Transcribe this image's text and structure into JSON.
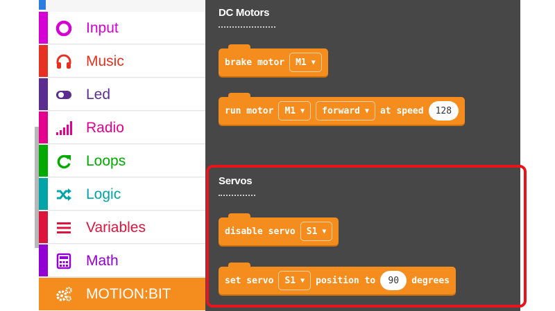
{
  "toolbox": {
    "categories": [
      {
        "label": "Input",
        "icon": "circle-dot-icon",
        "color": "#d400d4"
      },
      {
        "label": "Music",
        "icon": "headphones-icon",
        "color": "#e63022"
      },
      {
        "label": "Led",
        "icon": "toggle-icon",
        "color": "#5c2d91"
      },
      {
        "label": "Radio",
        "icon": "signal-bars-icon",
        "color": "#e3008c"
      },
      {
        "label": "Loops",
        "icon": "refresh-icon",
        "color": "#00aa00"
      },
      {
        "label": "Logic",
        "icon": "shuffle-icon",
        "color": "#00a4a6"
      },
      {
        "label": "Variables",
        "icon": "lines-icon",
        "color": "#dc143c"
      },
      {
        "label": "Math",
        "icon": "calculator-icon",
        "color": "#9400d3"
      },
      {
        "label": "MOTION:BIT",
        "icon": "gears-icon",
        "color": "#f48c1e"
      }
    ]
  },
  "flyout": {
    "sections": [
      {
        "heading": "DC Motors",
        "blocks": [
          {
            "parts": [
              {
                "type": "text",
                "value": "brake motor"
              },
              {
                "type": "dropdown",
                "value": "M1"
              }
            ]
          },
          {
            "parts": [
              {
                "type": "text",
                "value": "run motor"
              },
              {
                "type": "dropdown",
                "value": "M1"
              },
              {
                "type": "dropdown",
                "value": "forward"
              },
              {
                "type": "text",
                "value": "at speed"
              },
              {
                "type": "number",
                "value": "128"
              }
            ]
          }
        ]
      },
      {
        "heading": "Servos",
        "blocks": [
          {
            "parts": [
              {
                "type": "text",
                "value": "disable servo"
              },
              {
                "type": "dropdown",
                "value": "S1"
              }
            ]
          },
          {
            "parts": [
              {
                "type": "text",
                "value": "set servo"
              },
              {
                "type": "dropdown",
                "value": "S1"
              },
              {
                "type": "text",
                "value": "position to"
              },
              {
                "type": "number",
                "value": "90"
              },
              {
                "type": "text",
                "value": "degrees"
              }
            ]
          }
        ]
      }
    ]
  },
  "colors": {
    "accent": "#f48c1e",
    "workspace": "#474747",
    "highlight": "#e8141c"
  }
}
